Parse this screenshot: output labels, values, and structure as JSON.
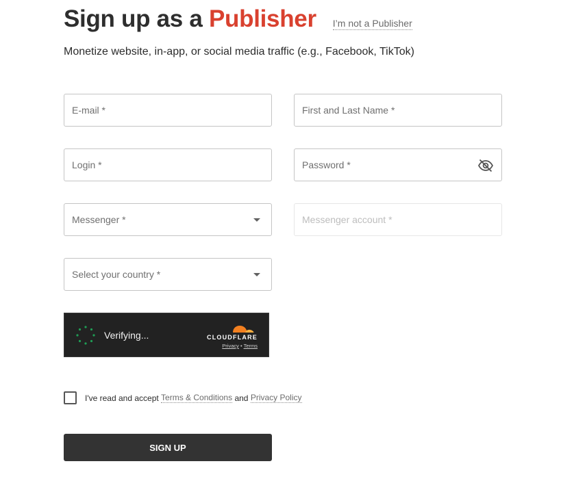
{
  "header": {
    "title_prefix": "Sign up as a ",
    "title_accent": "Publisher",
    "not_publisher_link": "I’m not a Publisher",
    "subtitle": "Monetize website, in-app, or social media traffic (e.g., Facebook, TikTok)"
  },
  "form": {
    "email": {
      "placeholder": "E-mail *"
    },
    "full_name": {
      "placeholder": "First and Last Name *"
    },
    "login": {
      "placeholder": "Login *"
    },
    "password": {
      "placeholder": "Password *",
      "icon": "eye-off-icon"
    },
    "messenger": {
      "placeholder": "Messenger *",
      "icon": "caret-down-icon"
    },
    "messenger_account": {
      "placeholder": "Messenger account *",
      "disabled": true
    },
    "country": {
      "placeholder": "Select your country *",
      "icon": "caret-down-icon"
    }
  },
  "captcha": {
    "status": "Verifying...",
    "brand": "CLOUDFLARE",
    "privacy": "Privacy",
    "separator": "•",
    "terms": "Terms"
  },
  "agreement": {
    "prefix": "I've read and accept",
    "terms_link": "Terms & Conditions",
    "and": "and",
    "privacy_link": "Privacy Policy"
  },
  "submit": {
    "label": "SIGN UP"
  },
  "colors": {
    "accent": "#d9412f",
    "button_bg": "#333333",
    "captcha_bg": "#222222",
    "cloudflare_orange": "#f38020",
    "spinner_green": "#1f9d55"
  }
}
